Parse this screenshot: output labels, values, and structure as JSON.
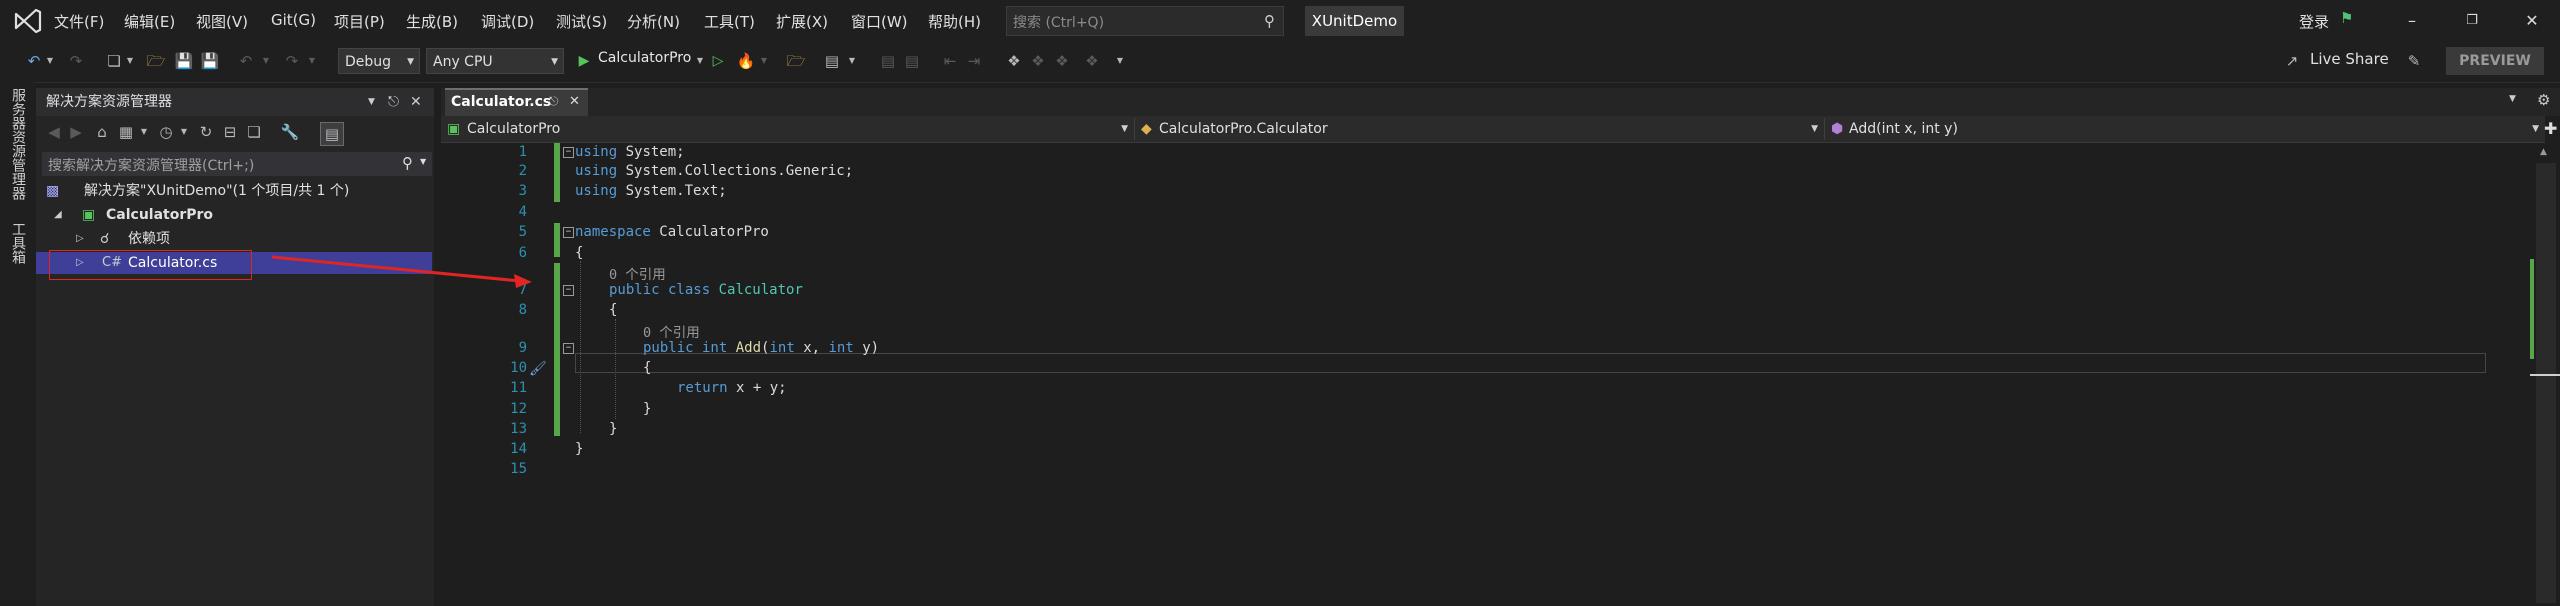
{
  "menu": {
    "items": [
      "文件(F)",
      "编辑(E)",
      "视图(V)",
      "Git(G)",
      "项目(P)",
      "生成(B)",
      "调试(D)",
      "测试(S)",
      "分析(N)",
      "工具(T)",
      "扩展(X)",
      "窗口(W)",
      "帮助(H)"
    ],
    "search_placeholder": "搜索 (Ctrl+Q)",
    "solution_name": "XUnitDemo",
    "login_label": "登录"
  },
  "toolbar": {
    "config_value": "Debug",
    "platform_value": "Any CPU",
    "start_target": "CalculatorPro",
    "live_share_label": "Live Share",
    "preview_label": "PREVIEW"
  },
  "left_strip": {
    "tabs": [
      "服务器资源管理器",
      "工具箱"
    ]
  },
  "solution_explorer": {
    "title": "解决方案资源管理器",
    "search_placeholder": "搜索解决方案资源管理器(Ctrl+;)",
    "solution_label": "解决方案\"XUnitDemo\"(1 个项目/共 1 个)",
    "project_label": "CalculatorPro",
    "deps_label": "依赖项",
    "file_label": "Calculator.cs"
  },
  "editor": {
    "tab_label": "Calculator.cs",
    "nav_project": "CalculatorPro",
    "nav_class": "CalculatorPro.Calculator",
    "nav_member": "Add(int x, int y)",
    "ref_hint": "0 个引用",
    "line_numbers": [
      "1",
      "2",
      "3",
      "4",
      "5",
      "6",
      "7",
      "8",
      "9",
      "10",
      "11",
      "12",
      "13",
      "14",
      "15"
    ]
  },
  "colors": {
    "accent_highlight": "#e02525",
    "selection_blue": "#3f3f9a",
    "keyword": "#569cd6",
    "type": "#4ec9b0",
    "method": "#dcdcaa",
    "change_bar": "#57a64a"
  }
}
